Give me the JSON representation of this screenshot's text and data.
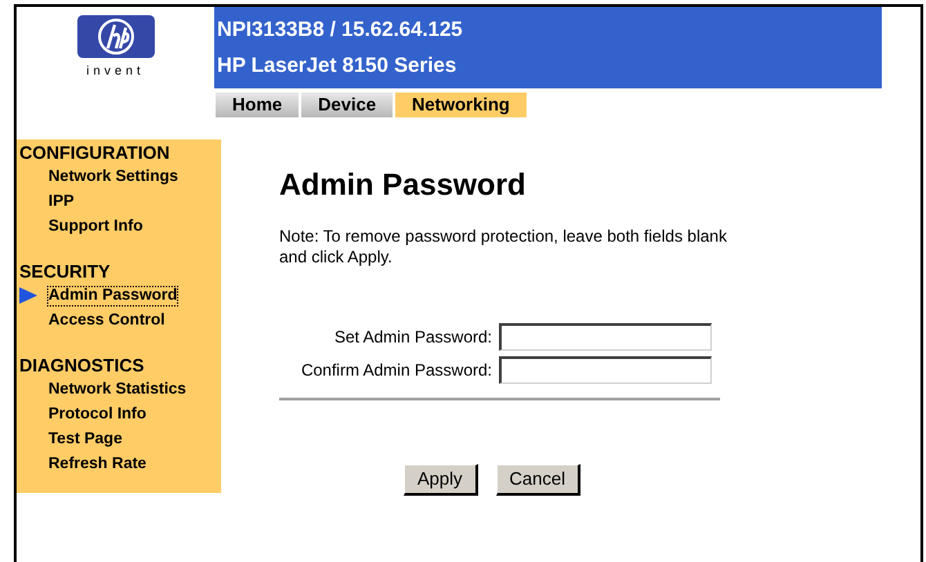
{
  "logo": {
    "tagline": "invent"
  },
  "header": {
    "device": "NPI3133B8 / 15.62.64.125",
    "model": "HP LaserJet 8150 Series"
  },
  "tabs": [
    {
      "label": "Home",
      "selected": false
    },
    {
      "label": "Device",
      "selected": false
    },
    {
      "label": "Networking",
      "selected": true
    }
  ],
  "sidebar": {
    "sections": [
      {
        "title": "CONFIGURATION",
        "items": [
          {
            "label": "Network Settings",
            "selected": false
          },
          {
            "label": "IPP",
            "selected": false
          },
          {
            "label": "Support Info",
            "selected": false
          }
        ]
      },
      {
        "title": "SECURITY",
        "items": [
          {
            "label": "Admin Password",
            "selected": true
          },
          {
            "label": "Access Control",
            "selected": false
          }
        ]
      },
      {
        "title": "DIAGNOSTICS",
        "items": [
          {
            "label": "Network Statistics",
            "selected": false
          },
          {
            "label": "Protocol Info",
            "selected": false
          },
          {
            "label": "Test Page",
            "selected": false
          },
          {
            "label": "Refresh Rate",
            "selected": false
          }
        ]
      }
    ]
  },
  "page": {
    "title": "Admin Password",
    "note": "Note: To remove password protection, leave both fields blank and click Apply.",
    "fields": [
      {
        "label": "Set Admin Password:"
      },
      {
        "label": "Confirm Admin Password:"
      }
    ],
    "buttons": [
      "Apply",
      "Cancel"
    ]
  }
}
